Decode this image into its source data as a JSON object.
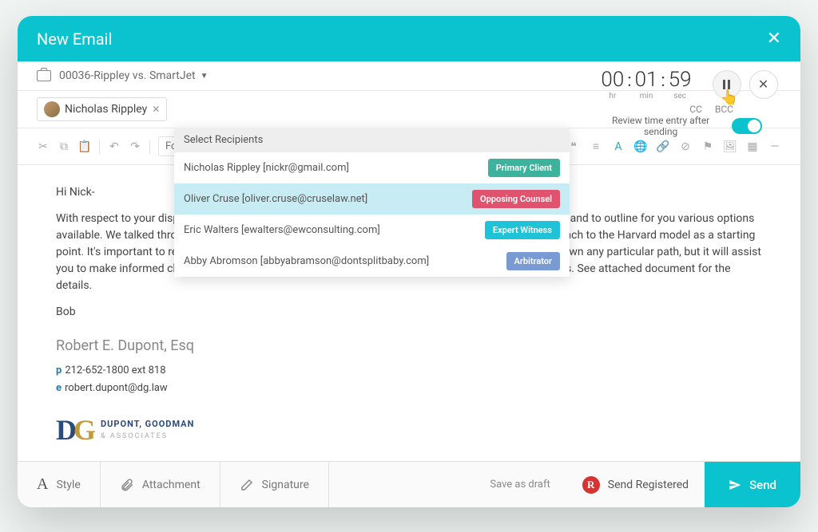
{
  "header": {
    "title": "New Email"
  },
  "case": {
    "name": "00036-Rippley vs. SmartJet"
  },
  "timer": {
    "hr": "00",
    "min": "01",
    "sec": "59",
    "hr_lbl": "hr",
    "min_lbl": "min",
    "sec_lbl": "sec",
    "review_label": "Review time entry after sending"
  },
  "recipient_chip": {
    "name": "Nicholas Rippley"
  },
  "cc": "CC",
  "bcc": "BCC",
  "recipients_dropdown": {
    "header": "Select Recipients",
    "items": [
      {
        "label": "Nicholas Rippley [nickr@gmail.com]",
        "role": "Primary Client",
        "role_class": "role-primary"
      },
      {
        "label": "Oliver Cruse [oliver.cruse@cruselaw.net]",
        "role": "Opposing Counsel",
        "role_class": "role-opposing",
        "highlighted": true
      },
      {
        "label": "Eric Walters [ewalters@ewconsulting.com]",
        "role": "Expert Witness",
        "role_class": "role-expert"
      },
      {
        "label": "Abby Abromson [abbyabramson@dontsplitbaby.com]",
        "role": "Arbitrator",
        "role_class": "role-arbitrator"
      }
    ]
  },
  "toolbar": {
    "font": "Font"
  },
  "body": {
    "greeting": "Hi Nick-",
    "para": "With respect to your dispute, you've engaged our firm to assess the various approaching circumstances and to outline for you various options available. We talked throughout whether a hearing is unanimous — but as a starting point for this approach to the Harvard model as a starting point. It's important to remember that undertaking this preparation does not preclude you from going down any particular path, but it will assist you to make informed choices about which option is likely to go furthest toward satisfying your interests.  See attached document for the details.",
    "signoff": "Bob"
  },
  "signature": {
    "name": "Robert E. Dupont, Esq",
    "phone": "212-652-1800 ext 818",
    "email": "robert.dupont@dg.law",
    "firm": "DUPONT, GOODMAN",
    "firm_sub": "& ASSOCIATES"
  },
  "footer": {
    "style": "Style",
    "attachment": "Attachment",
    "signature": "Signature",
    "draft": "Save as draft",
    "registered": "Send Registered",
    "send": "Send"
  }
}
